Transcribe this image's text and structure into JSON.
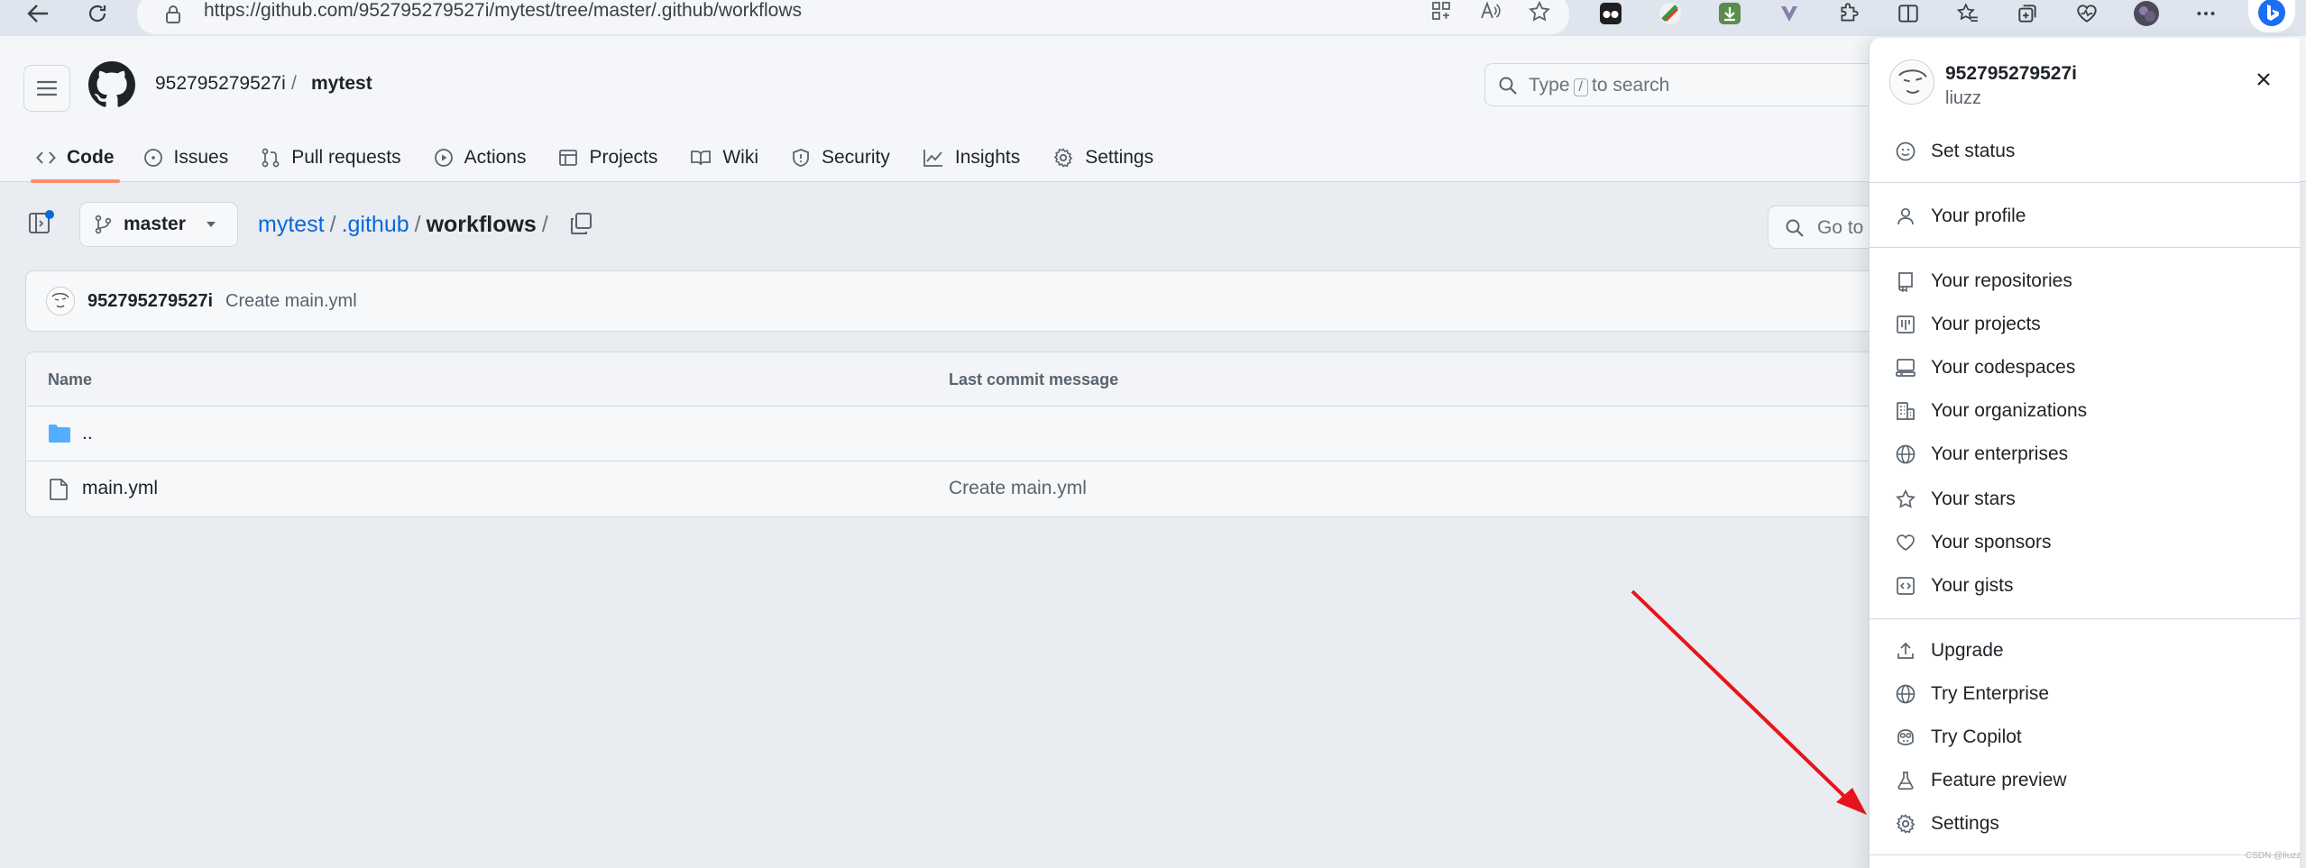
{
  "browser": {
    "url": "https://github.com/952795279527i/mytest/tree/master/.github/workflows"
  },
  "header": {
    "owner": "952795279527i",
    "separator": "/",
    "repo": "mytest",
    "search_prefix": "Type",
    "search_key": "/",
    "search_suffix": "to search",
    "tabs": [
      {
        "label": "Code",
        "icon": "code-icon",
        "active": true
      },
      {
        "label": "Issues",
        "icon": "issue-icon"
      },
      {
        "label": "Pull requests",
        "icon": "pull-request-icon"
      },
      {
        "label": "Actions",
        "icon": "play-icon"
      },
      {
        "label": "Projects",
        "icon": "table-icon"
      },
      {
        "label": "Wiki",
        "icon": "book-icon"
      },
      {
        "label": "Security",
        "icon": "shield-icon"
      },
      {
        "label": "Insights",
        "icon": "graph-icon"
      },
      {
        "label": "Settings",
        "icon": "gear-icon"
      }
    ]
  },
  "repo": {
    "branch": "master",
    "path": {
      "root": "mytest",
      "sep1": "/",
      "dir1": ".github",
      "sep2": "/",
      "current": "workflows",
      "sep3": "/"
    },
    "goto_placeholder": "Go to",
    "commit": {
      "user": "952795279527i",
      "message": "Create main.yml"
    },
    "table": {
      "col_name": "Name",
      "col_message": "Last commit message",
      "rows": [
        {
          "name": "..",
          "message": "",
          "icon": "folder-icon"
        },
        {
          "name": "main.yml",
          "message": "Create main.yml",
          "icon": "file-icon"
        }
      ]
    }
  },
  "user_menu": {
    "login": "952795279527i",
    "name": "liuzz",
    "items": [
      {
        "label": "Set status",
        "icon": "smiley-icon"
      },
      {
        "label": "Your profile",
        "icon": "person-icon"
      },
      {
        "label": "Your repositories",
        "icon": "repo-icon"
      },
      {
        "label": "Your projects",
        "icon": "project-icon"
      },
      {
        "label": "Your codespaces",
        "icon": "codespaces-icon"
      },
      {
        "label": "Your organizations",
        "icon": "organization-icon"
      },
      {
        "label": "Your enterprises",
        "icon": "globe-icon"
      },
      {
        "label": "Your stars",
        "icon": "star-icon"
      },
      {
        "label": "Your sponsors",
        "icon": "heart-icon"
      },
      {
        "label": "Your gists",
        "icon": "code-square-icon"
      },
      {
        "label": "Upgrade",
        "icon": "upload-icon"
      },
      {
        "label": "Try Enterprise",
        "icon": "globe-icon"
      },
      {
        "label": "Try Copilot",
        "icon": "copilot-icon"
      },
      {
        "label": "Feature preview",
        "icon": "beaker-icon"
      },
      {
        "label": "Settings",
        "icon": "gear-icon"
      }
    ]
  },
  "colors": {
    "link": "#0969da",
    "tab_underline": "#fd8c73",
    "annotation_arrow": "#e8141b",
    "folder": "#54aeff"
  },
  "watermark": "CSDN @liuzz"
}
